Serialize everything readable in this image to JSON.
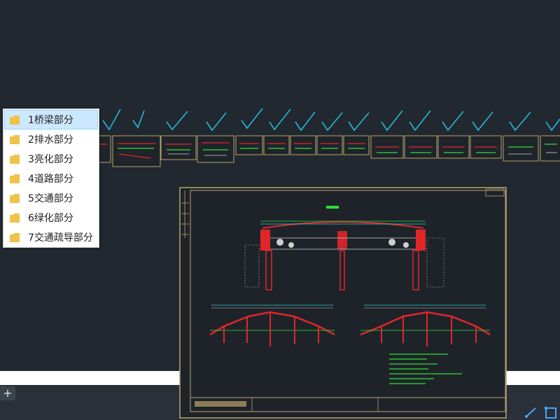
{
  "colors": {
    "canvas_bg": "#212830",
    "check_mark": "#27b8d8",
    "sheet_border": "#b9a46a",
    "cad_red": "#e0262a",
    "cad_green": "#2fe02f",
    "cad_cyan": "#28d8d8",
    "menu_selected": "#cce8ff"
  },
  "context_menu": {
    "items": [
      {
        "label": "1桥梁部分",
        "selected": true
      },
      {
        "label": "2排水部分",
        "selected": false
      },
      {
        "label": "3亮化部分",
        "selected": false
      },
      {
        "label": "4道路部分",
        "selected": false
      },
      {
        "label": "5交通部分",
        "selected": false
      },
      {
        "label": "6绿化部分",
        "selected": false
      },
      {
        "label": "7交通疏导部分",
        "selected": false
      }
    ]
  },
  "layout_tabs": {
    "add_label": "+"
  },
  "icons": {
    "folder": "folder-icon",
    "check": "check-mark-icon",
    "add": "plus-icon",
    "measure": "measure-icon",
    "selection": "selection-icon"
  }
}
